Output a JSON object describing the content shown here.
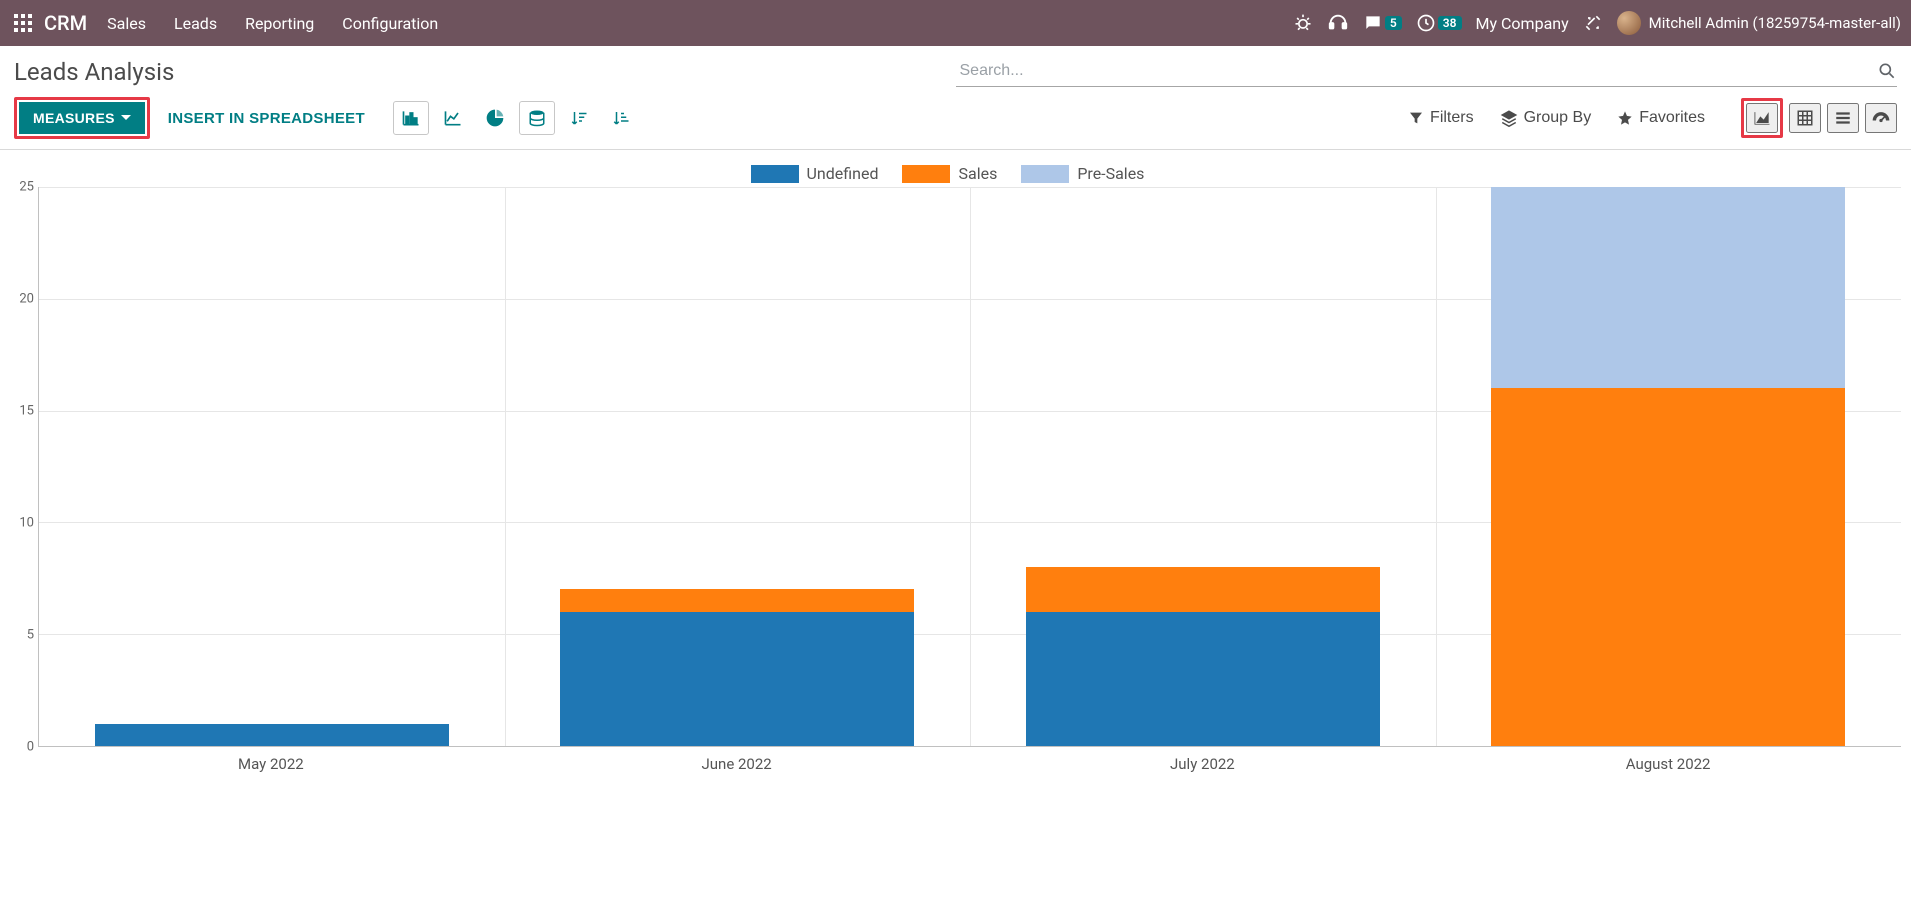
{
  "topnav": {
    "brand": "CRM",
    "menu": [
      "Sales",
      "Leads",
      "Reporting",
      "Configuration"
    ],
    "messages_badge": "5",
    "timer_badge": "38",
    "company": "My Company",
    "user": "Mitchell Admin (18259754-master-all)"
  },
  "page": {
    "title": "Leads Analysis",
    "search_placeholder": "Search..."
  },
  "toolbar": {
    "measures_label": "MEASURES",
    "insert_label": "INSERT IN SPREADSHEET",
    "filters_label": "Filters",
    "groupby_label": "Group By",
    "favorites_label": "Favorites"
  },
  "chart_data": {
    "type": "bar",
    "stacked": true,
    "categories": [
      "May 2022",
      "June 2022",
      "July 2022",
      "August 2022"
    ],
    "series": [
      {
        "name": "Undefined",
        "color": "#1f77b4",
        "values": [
          1,
          6,
          6,
          0
        ]
      },
      {
        "name": "Sales",
        "color": "#ff7f0e",
        "values": [
          0,
          1,
          2,
          16
        ]
      },
      {
        "name": "Pre-Sales",
        "color": "#aec7e8",
        "values": [
          0,
          0,
          0,
          9
        ]
      }
    ],
    "ylim": [
      0,
      25
    ],
    "yticks": [
      0,
      5,
      10,
      15,
      20,
      25
    ],
    "xlabel": "",
    "ylabel": ""
  },
  "colors": {
    "primary": "#017e84",
    "navbar": "#6e535d",
    "highlight": "#e63946"
  }
}
